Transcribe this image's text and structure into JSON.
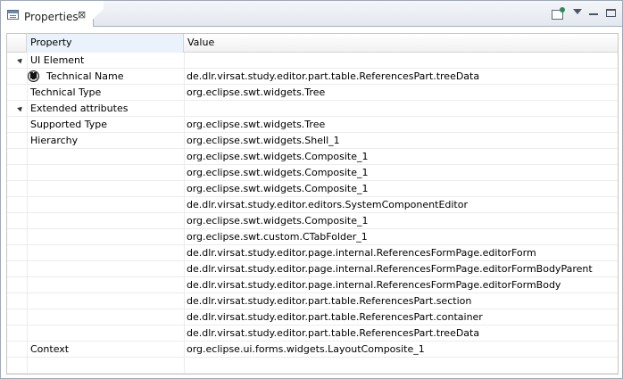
{
  "view": {
    "title": "Properties",
    "close_glyph": "⊠",
    "toolbar": [
      {
        "name": "pin-icon"
      },
      {
        "name": "view-menu-icon"
      },
      {
        "name": "minimize-icon"
      },
      {
        "name": "maximize-icon"
      }
    ]
  },
  "table": {
    "columns": {
      "property": "Property",
      "value": "Value"
    },
    "rows": [
      {
        "property": "UI Element",
        "value": "",
        "group": true
      },
      {
        "property": "Technical Name",
        "value": "de.dlr.virsat.study.editor.part.table.ReferencesPart.treeData",
        "icon": "technical-name-icon"
      },
      {
        "property": "Technical Type",
        "value": "org.eclipse.swt.widgets.Tree"
      },
      {
        "property": "Extended attributes",
        "value": "",
        "group": true
      },
      {
        "property": "Supported Type",
        "value": "org.eclipse.swt.widgets.Tree"
      },
      {
        "property": "Hierarchy",
        "value": "org.eclipse.swt.widgets.Shell_1"
      },
      {
        "property": "",
        "value": "org.eclipse.swt.widgets.Composite_1"
      },
      {
        "property": "",
        "value": "org.eclipse.swt.widgets.Composite_1"
      },
      {
        "property": "",
        "value": "org.eclipse.swt.widgets.Composite_1"
      },
      {
        "property": "",
        "value": "de.dlr.virsat.study.editor.editors.SystemComponentEditor"
      },
      {
        "property": "",
        "value": "org.eclipse.swt.widgets.Composite_1"
      },
      {
        "property": "",
        "value": "org.eclipse.swt.custom.CTabFolder_1"
      },
      {
        "property": "",
        "value": "de.dlr.virsat.study.editor.page.internal.ReferencesFormPage.editorForm"
      },
      {
        "property": "",
        "value": "de.dlr.virsat.study.editor.page.internal.ReferencesFormPage.editorFormBodyParent"
      },
      {
        "property": "",
        "value": "de.dlr.virsat.study.editor.page.internal.ReferencesFormPage.editorFormBody"
      },
      {
        "property": "",
        "value": "de.dlr.virsat.study.editor.part.table.ReferencesPart.section"
      },
      {
        "property": "",
        "value": "de.dlr.virsat.study.editor.part.table.ReferencesPart.container"
      },
      {
        "property": "",
        "value": "de.dlr.virsat.study.editor.part.table.ReferencesPart.treeData"
      },
      {
        "property": "Context",
        "value": "org.eclipse.ui.forms.widgets.LayoutComposite_1"
      },
      {
        "property": "",
        "value": ""
      }
    ]
  }
}
